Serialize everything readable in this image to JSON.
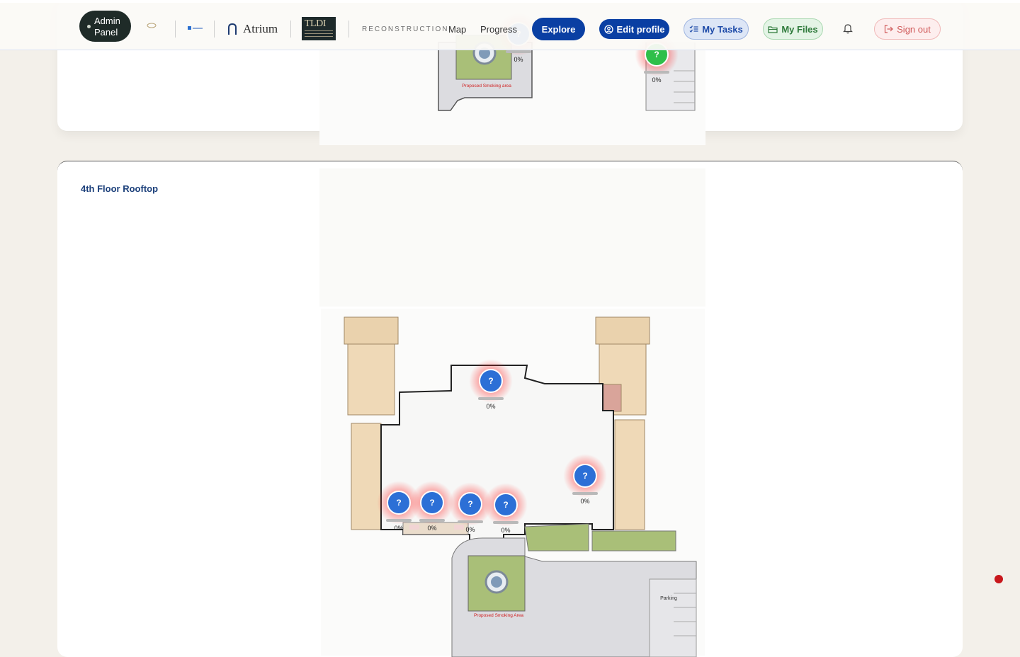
{
  "header": {
    "admin_panel": "Admin\nPanel",
    "atrium": "Atrium",
    "tldi": "TLDI",
    "reconstruction": "RECONSTRUCTION",
    "nav": {
      "map": "Map",
      "progress": "Progress"
    },
    "explore": "Explore",
    "edit_profile": "Edit profile",
    "my_tasks": "My Tasks",
    "my_files": "My Files",
    "sign_out": "Sign out"
  },
  "floors": [
    {
      "title": "",
      "labels": {
        "smoking": "Proposed Smoking area"
      },
      "markers": [
        {
          "label": "?",
          "progress": "0%",
          "color": "blue"
        },
        {
          "label": "?",
          "progress": "0%",
          "color": "green"
        }
      ]
    },
    {
      "title": "4th Floor Rooftop",
      "labels": {
        "smoking": "Proposed Smoking Area",
        "parking": "Parking"
      },
      "markers": [
        {
          "label": "?",
          "progress": "0%",
          "color": "blue"
        },
        {
          "label": "?",
          "progress": "0%",
          "color": "blue"
        },
        {
          "label": "?",
          "progress": "0%",
          "color": "blue"
        },
        {
          "label": "?",
          "progress": "0%",
          "color": "blue"
        },
        {
          "label": "?",
          "progress": "0%",
          "color": "blue"
        },
        {
          "label": "?",
          "progress": "0%",
          "color": "blue"
        }
      ]
    }
  ],
  "colors": {
    "primary": "#0a3fa3",
    "marker_blue": "#2c6fd6",
    "marker_green": "#2fbf4a",
    "glow": "#ff2828",
    "signout": "#d05a5a"
  }
}
